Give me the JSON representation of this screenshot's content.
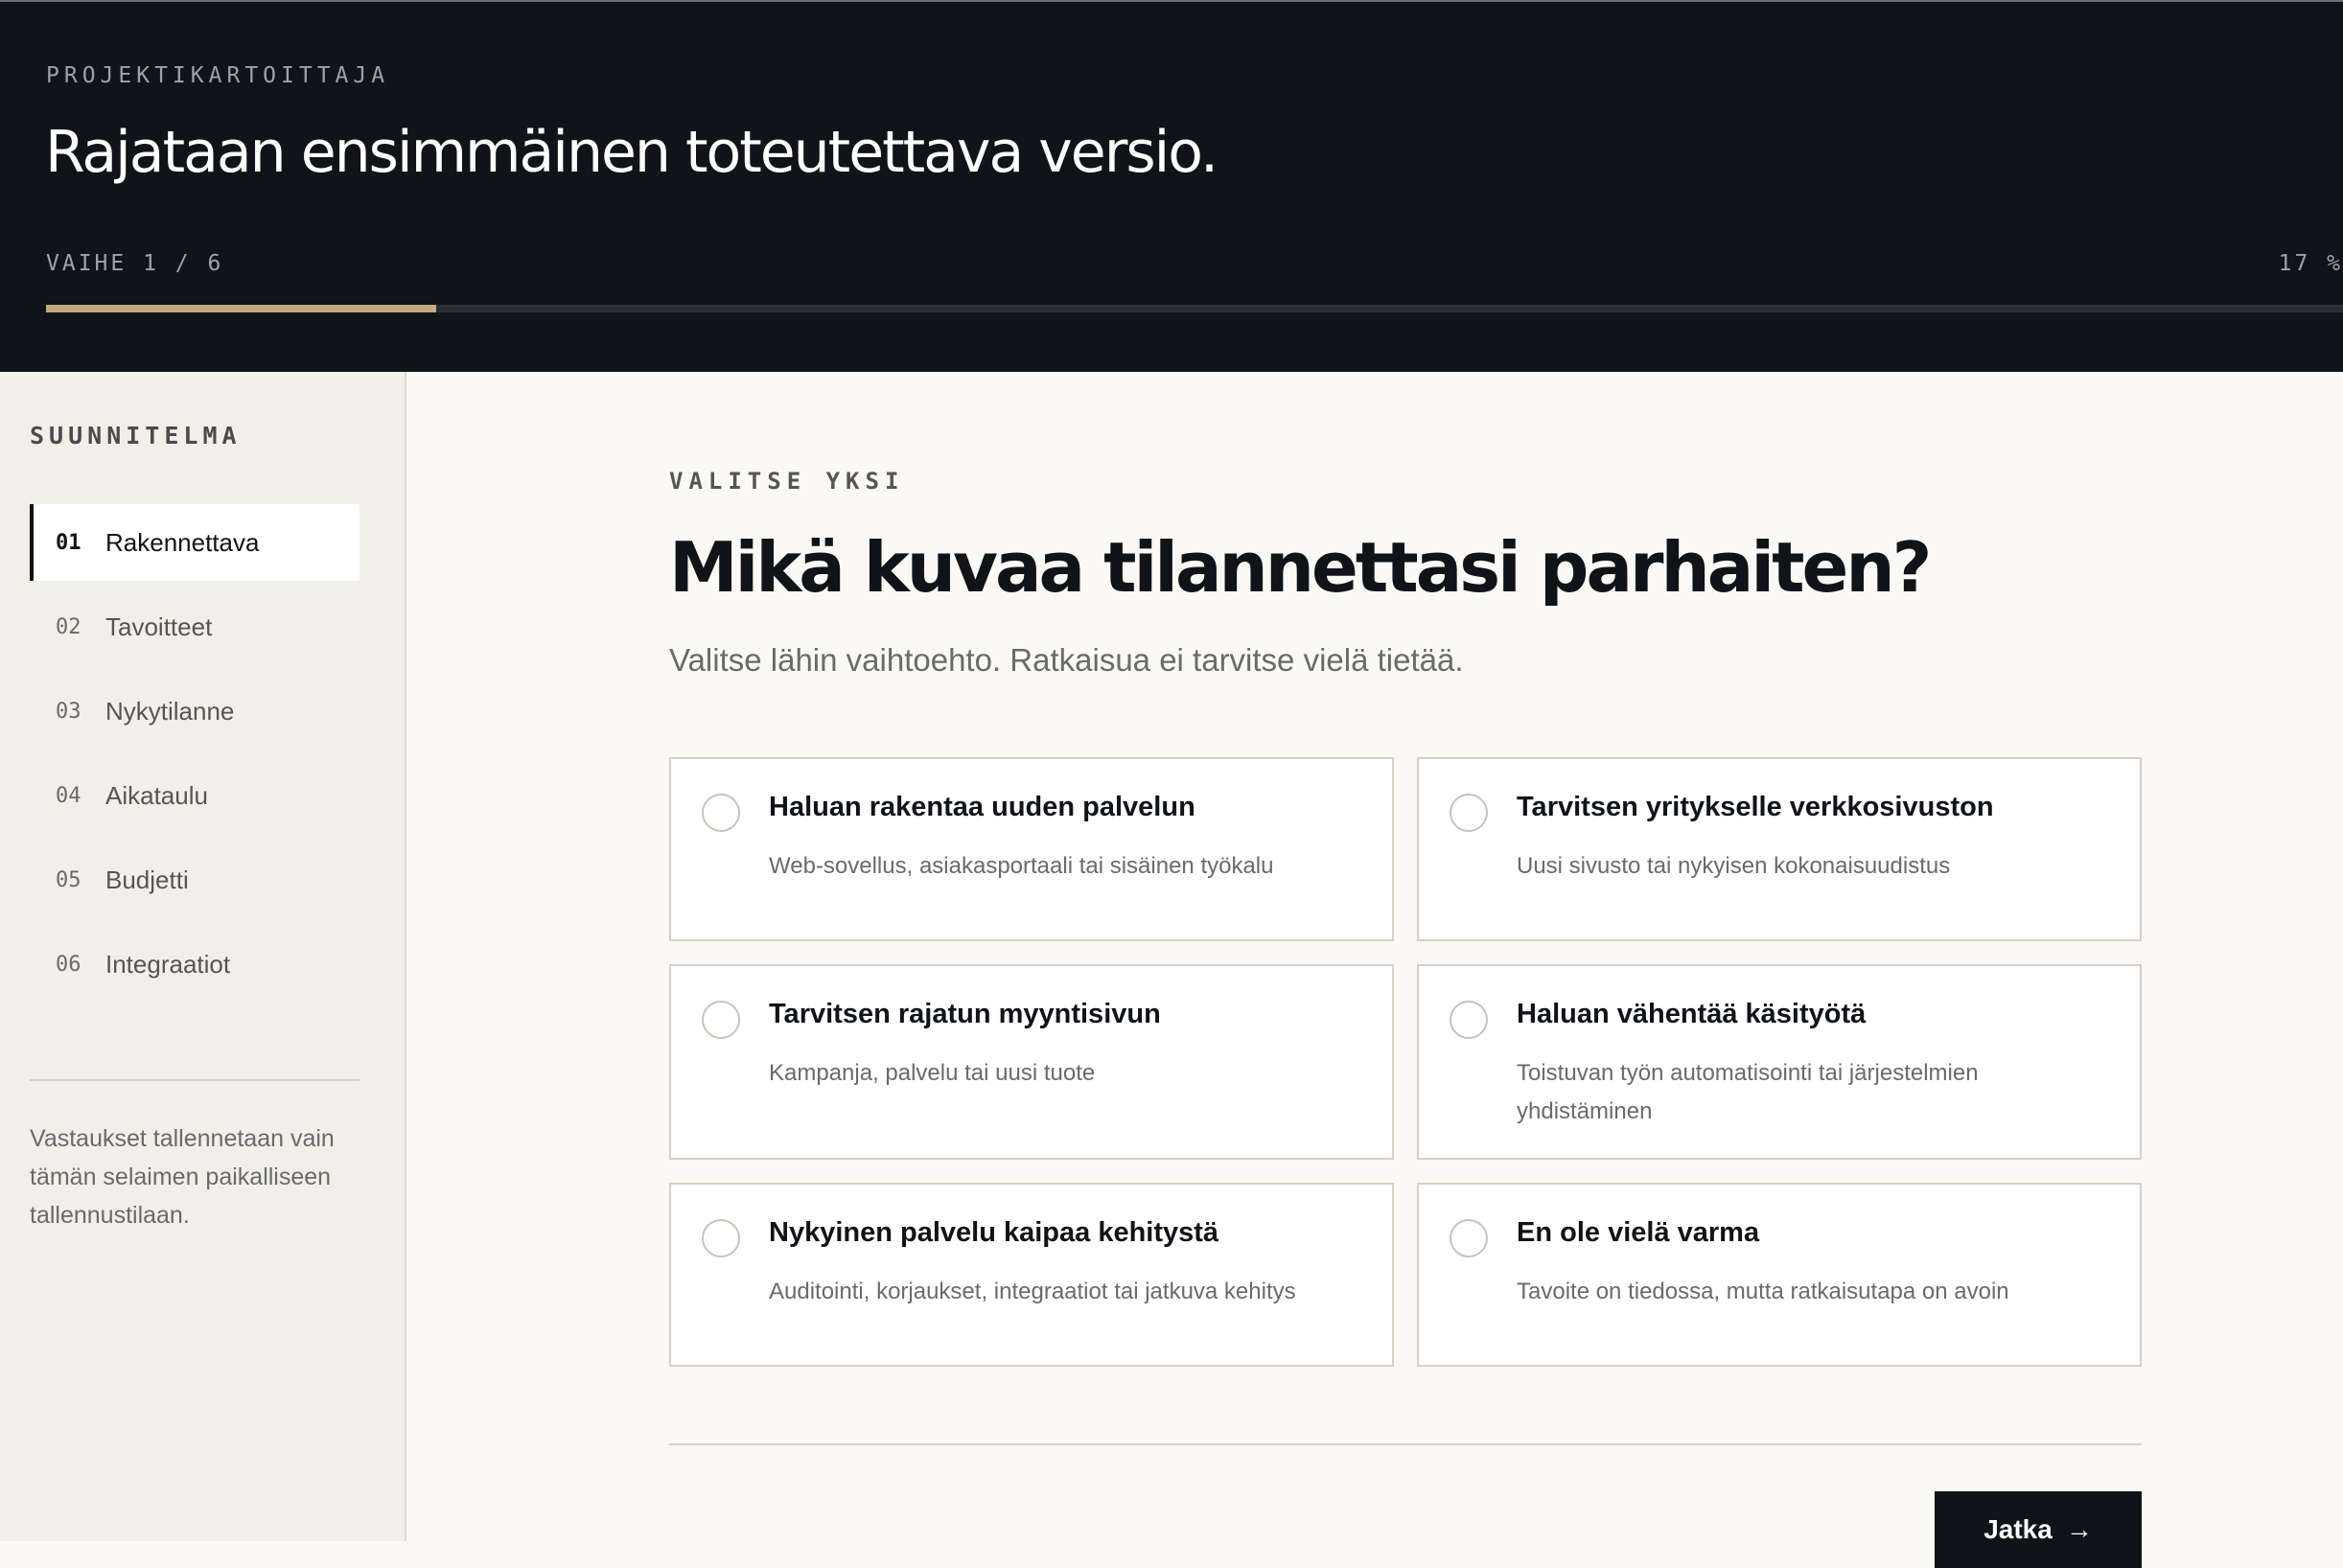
{
  "header": {
    "eyebrow": "PROJEKTIKARTOITTAJA",
    "title": "Rajataan ensimmäinen toteutettava versio.",
    "step_label": "VAIHE 1 / 6",
    "progress_percent_label": "17 %",
    "progress_fraction": 0.17
  },
  "sidebar": {
    "title": "SUUNNITELMA",
    "items": [
      {
        "num": "01",
        "label": "Rakennettava",
        "active": true
      },
      {
        "num": "02",
        "label": "Tavoitteet",
        "active": false
      },
      {
        "num": "03",
        "label": "Nykytilanne",
        "active": false
      },
      {
        "num": "04",
        "label": "Aikataulu",
        "active": false
      },
      {
        "num": "05",
        "label": "Budjetti",
        "active": false
      },
      {
        "num": "06",
        "label": "Integraatiot",
        "active": false
      }
    ],
    "note": "Vastaukset tallennetaan vain tämän selaimen paikalliseen tallennustilaan."
  },
  "main": {
    "kicker": "VALITSE YKSI",
    "question": "Mikä kuvaa tilannettasi parhaiten?",
    "subtitle": "Valitse lähin vaihtoehto. Ratkaisua ei tarvitse vielä tietää.",
    "options": [
      {
        "title": "Haluan rakentaa uuden palvelun",
        "desc": "Web-sovellus, asiakasportaali tai sisäinen työkalu"
      },
      {
        "title": "Tarvitsen yritykselle verkkosivuston",
        "desc": "Uusi sivusto tai nykyisen kokonaisuudistus"
      },
      {
        "title": "Tarvitsen rajatun myyntisivun",
        "desc": "Kampanja, palvelu tai uusi tuote"
      },
      {
        "title": "Haluan vähentää käsityötä",
        "desc": "Toistuvan työn automatisointi tai järjestelmien yhdistäminen"
      },
      {
        "title": "Nykyinen palvelu kaipaa kehitystä",
        "desc": "Auditointi, korjaukset, integraatiot tai jatkuva kehitys"
      },
      {
        "title": "En ole vielä varma",
        "desc": "Tavoite on tiedossa, mutta ratkaisutapa on avoin"
      }
    ],
    "continue_label": "Jatka",
    "continue_icon": "arrow-right-icon"
  },
  "colors": {
    "header_bg": "#101318",
    "accent": "#c5a97c",
    "sidebar_bg": "#f2efe9",
    "content_bg": "#faf9f6"
  }
}
